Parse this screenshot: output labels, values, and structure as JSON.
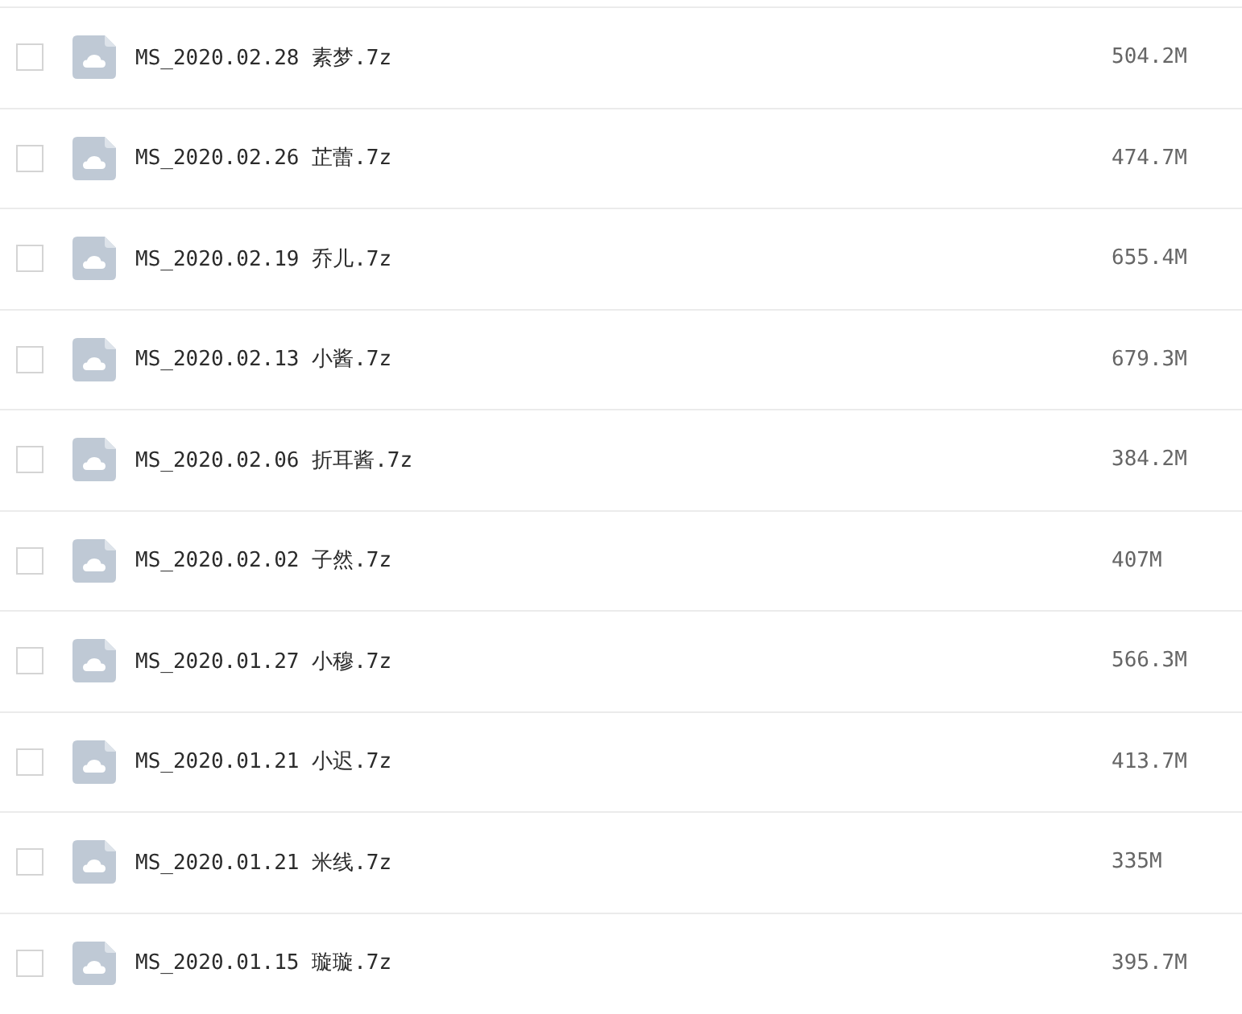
{
  "files": [
    {
      "name": "MS_2020.02.28 素梦.7z",
      "size": "504.2M",
      "checked": false
    },
    {
      "name": "MS_2020.02.26 芷蕾.7z",
      "size": "474.7M",
      "checked": false
    },
    {
      "name": "MS_2020.02.19 乔儿.7z",
      "size": "655.4M",
      "checked": false
    },
    {
      "name": "MS_2020.02.13 小酱.7z",
      "size": "679.3M",
      "checked": false
    },
    {
      "name": "MS_2020.02.06 折耳酱.7z",
      "size": "384.2M",
      "checked": false
    },
    {
      "name": "MS_2020.02.02 子然.7z",
      "size": "407M",
      "checked": false
    },
    {
      "name": "MS_2020.01.27 小穆.7z",
      "size": "566.3M",
      "checked": false
    },
    {
      "name": "MS_2020.01.21 小迟.7z",
      "size": "413.7M",
      "checked": false
    },
    {
      "name": "MS_2020.01.21 米线.7z",
      "size": "335M",
      "checked": false
    },
    {
      "name": "MS_2020.01.15 璇璇.7z",
      "size": "395.7M",
      "checked": false
    }
  ]
}
